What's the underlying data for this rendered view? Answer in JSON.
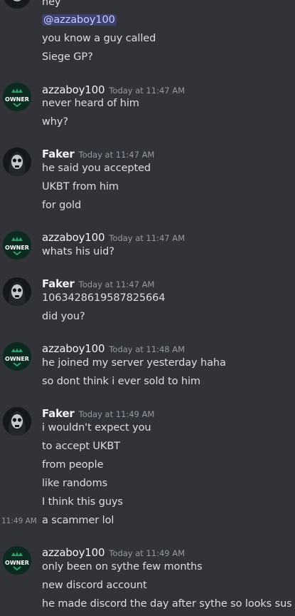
{
  "messages": {
    "top": {
      "lines": [
        "hey",
        "@azzaboy100",
        "you know a guy called",
        "Siege GP?"
      ]
    },
    "m1": {
      "user": "azzaboy100",
      "time": "Today at 11:47 AM",
      "lines": [
        "never heard of him",
        "why?"
      ]
    },
    "m2": {
      "user": "Faker",
      "time": "Today at 11:47 AM",
      "lines": [
        "he said you accepted",
        "UKBT from him",
        "for gold"
      ]
    },
    "m3": {
      "user": "azzaboy100",
      "time": "Today at 11:47 AM",
      "lines": [
        "whats his uid?"
      ]
    },
    "m4": {
      "user": "Faker",
      "time": "Today at 11:47 AM",
      "lines": [
        "1063428619587825664",
        "did you?"
      ]
    },
    "m5": {
      "user": "azzaboy100",
      "time": "Today at 11:48 AM",
      "lines": [
        "he joined my server yesterday haha",
        "so dont think i ever sold to him"
      ]
    },
    "m6": {
      "user": "Faker",
      "time": "Today at 11:49 AM",
      "lines": [
        "i wouldn't expect you",
        "to accept UKBT",
        "from people",
        "like randoms",
        "I think this guys",
        "a scammer lol"
      ],
      "hover_time": "11:49 AM"
    },
    "m7": {
      "user": "azzaboy100",
      "time": "Today at 11:49 AM",
      "lines": [
        "only been on sythe few months",
        "new discord account",
        "he made discord the day after sythe so looks sus"
      ]
    }
  },
  "badges": {
    "owner_text": "OWNER"
  },
  "colors": {
    "background": "#313338",
    "owner_green": "#1f8b5b",
    "mention_bg": "#3c4270"
  }
}
